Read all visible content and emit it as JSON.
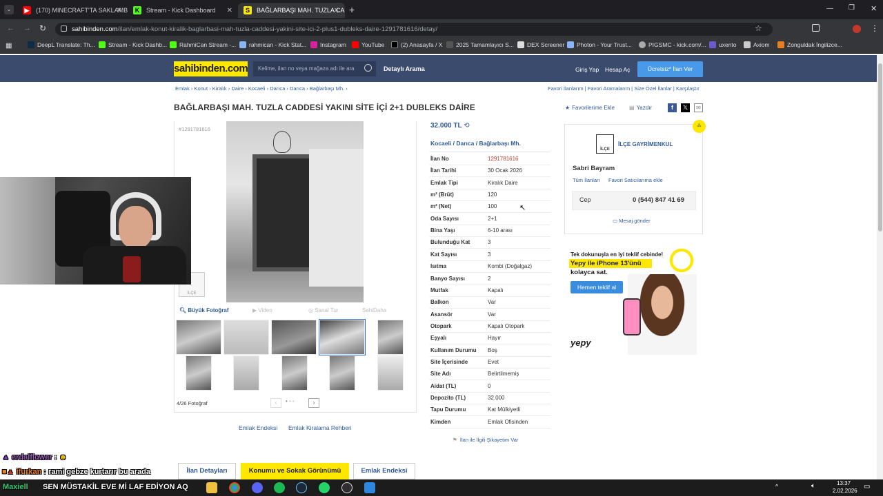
{
  "browser": {
    "tabs": [
      {
        "label": "(170) MINECRAFT'TA SAKLAMB",
        "icon": "youtube-icon",
        "color": "#ff0000"
      },
      {
        "label": "Stream - Kick Dashboard",
        "icon": "kick-icon",
        "color": "#53fc18"
      },
      {
        "label": "BAĞLARBAŞI MAH. TUZLA CADD",
        "icon": "sahibinden-icon",
        "color": "#ffe800"
      }
    ],
    "url_domain": "sahibinden.com",
    "url_path": "/ilan/emlak-konut-kiralik-baglarbasi-mah-tuzla-caddesi-yakini-site-ici-2-plus1-dubleks-daire-1291781616/detay/",
    "bookmarks": [
      "DeepL Translate: Th...",
      "Stream - Kick Dashb...",
      "RahmiCan Stream -...",
      "rahmican - Kick Stat...",
      "Instagram",
      "YouTube",
      "(2) Anasayfa / X",
      "2025 Tamamlayıcı S...",
      "DEX Screener",
      "Photon - Your Trust...",
      "PIGSMC - kick.com/...",
      "uxento",
      "Axiom",
      "Zonguldak İngilizce..."
    ]
  },
  "site": {
    "logo": "sahibinden.com",
    "search_placeholder": "Kelime, ilan no veya mağaza adı ile ara",
    "detailed_search": "Detaylı Arama",
    "login": "Giriş Yap",
    "register": "Hesap Aç",
    "free_ad": "Ücretsiz* İlan Ver"
  },
  "breadcrumb": [
    "Emlak",
    "Konut",
    "Kiralık",
    "Daire",
    "Kocaeli",
    "Darıca",
    "Darıca",
    "Bağlarbaşı Mh."
  ],
  "right_links": [
    "Favori İlanlarım",
    "Favori Aramalarım",
    "Size Özel İlanlar",
    "Karşılaştır"
  ],
  "listing": {
    "title": "BAĞLARBAŞI MAH. TUZLA CADDESİ YAKINI SİTE İÇİ 2+1 DUBLEKS DAİRE",
    "add_favorite": "Favorilerime Ekle",
    "print": "Yazdır",
    "listing_no_small": "#1291781616",
    "price": "32.000 TL",
    "location": [
      "Kocaeli",
      "Darıca",
      "Bağlarbaşı Mh."
    ],
    "photo_count": "4/26 Fotoğraf",
    "big_photo": "Büyük Fotoğraf",
    "video": "Video",
    "virtual_tour": "Sanal Tur",
    "sahibinden_logo_small": "SahiDaha",
    "links": [
      "Emlak Endeksi",
      "Emlak Kiralama Rehberi"
    ],
    "complaint": "İlan ile İlgili Şikayetim Var",
    "details": [
      {
        "k": "İlan No",
        "v": "1291781616"
      },
      {
        "k": "İlan Tarihi",
        "v": "30 Ocak 2026"
      },
      {
        "k": "Emlak Tipi",
        "v": "Kiralık Daire"
      },
      {
        "k": "m² (Brüt)",
        "v": "120"
      },
      {
        "k": "m² (Net)",
        "v": "100"
      },
      {
        "k": "Oda Sayısı",
        "v": "2+1"
      },
      {
        "k": "Bina Yaşı",
        "v": "6-10 arası"
      },
      {
        "k": "Bulunduğu Kat",
        "v": "3"
      },
      {
        "k": "Kat Sayısı",
        "v": "3"
      },
      {
        "k": "Isıtma",
        "v": "Kombi (Doğalgaz)"
      },
      {
        "k": "Banyo Sayısı",
        "v": "2"
      },
      {
        "k": "Mutfak",
        "v": "Kapalı"
      },
      {
        "k": "Balkon",
        "v": "Var"
      },
      {
        "k": "Asansör",
        "v": "Var"
      },
      {
        "k": "Otopark",
        "v": "Kapalı Otopark"
      },
      {
        "k": "Eşyalı",
        "v": "Hayır"
      },
      {
        "k": "Kullanım Durumu",
        "v": "Boş"
      },
      {
        "k": "Site İçerisinde",
        "v": "Evet"
      },
      {
        "k": "Site Adı",
        "v": "Belirtilmemiş"
      },
      {
        "k": "Aidat (TL)",
        "v": "0"
      },
      {
        "k": "Depozito (TL)",
        "v": "32.000"
      },
      {
        "k": "Tapu Durumu",
        "v": "Kat Mülkiyetli"
      },
      {
        "k": "Kimden",
        "v": "Emlak Ofisinden"
      }
    ]
  },
  "seller": {
    "agency": "İLÇE GAYRİMENKUL",
    "name": "Sabri Bayram",
    "all_listings": "Tüm İlanları",
    "add_fav_seller": "Favori Satıcılarıma ekle",
    "phone_label": "Cep",
    "phone": "0 (544) 847 41 69",
    "message": "Mesaj gönder"
  },
  "advert": {
    "line1": "Tek dokunuşla en iyi teklif cebinde!",
    "line2": "Yepy ile iPhone 13'ünü",
    "line3": "kolayca sat.",
    "cta": "Hemen teklif al",
    "brand": "yepy"
  },
  "bottom_tabs": [
    "İlan Detayları",
    "Konumu ve Sokak Görünümü",
    "Emlak Endeksi"
  ],
  "chat": [
    {
      "user": "erdalflower",
      "msg": ":"
    },
    {
      "user": "ifurkan",
      "msg": ": rami gebze kurtarır bu arada"
    }
  ],
  "overlay_text": "SEN MÜSTAKİL EVE Mİ LAF EDİYON AQ",
  "overlay_user": "Maxiell",
  "clock": {
    "time": "13:37",
    "date": "2.02.2026"
  },
  "colors": {
    "header": "#3b4b6e",
    "link": "#2f5a9b",
    "logo": "#ffe800",
    "free_ad": "#489ae9"
  }
}
